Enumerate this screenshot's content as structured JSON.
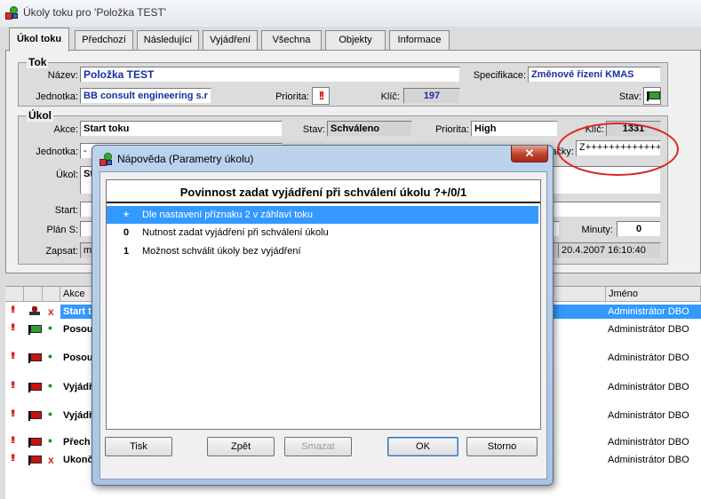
{
  "window": {
    "title": "Úkoly toku pro 'Položka TEST'"
  },
  "tabs": [
    "Úkol toku",
    "Předchozí",
    "Následující",
    "Vyjádření",
    "Všechna",
    "Objekty",
    "Informace"
  ],
  "tok": {
    "group_title": "Tok",
    "nazev_label": "Název:",
    "nazev_value": "Položka TEST",
    "specifikace_label": "Specifikace:",
    "specifikace_value": "Změnové řízení KMAS",
    "jednotka_label": "Jednotka:",
    "jednotka_value": "BB consult engineering s.r",
    "priorita_label": "Priorita:",
    "priorita_icon": "!!",
    "klic_label": "Klíč:",
    "klic_value": "197",
    "stav_label": "Stav:"
  },
  "ukol": {
    "group_title": "Úkol",
    "akce_label": "Akce:",
    "akce_value": "Start toku",
    "stav_label": "Stav:",
    "stav_value": "Schváleno",
    "priorita_label": "Priorita:",
    "priorita_value": "High",
    "klic_label": "Klíč:",
    "klic_value": "1331",
    "jednotka_label": "Jednotka:",
    "jednotka_value": "-",
    "znacky_label": "ačky:",
    "znacky_value": "Z+++++++++++++",
    "ukol_label": "Úkol:",
    "ukol_value": "St",
    "start_label": "Start:",
    "plan_label": "Plán S:",
    "plan_value": "",
    "minuty_label": "Minuty:",
    "minuty_value": "0",
    "zapsat_label": "Zapsat:",
    "zapsat_value": "m",
    "zapsat_date": "20.4.2007 16:10:40"
  },
  "grid": {
    "col_akce": "Akce",
    "col_jmeno": "Jméno",
    "rows": [
      {
        "prio": "!!",
        "icon": "stamp",
        "mark": "x",
        "akce": "Start t",
        "jmeno": "Administrátor DBO",
        "selected": true
      },
      {
        "prio": "!!",
        "icon": "flag-green",
        "mark": "•",
        "akce": "Posou",
        "jmeno": "Administrátor DBO",
        "selected": false
      },
      {
        "prio": "!!",
        "icon": "flag-red",
        "mark": "•",
        "akce": "Posou",
        "jmeno": "Administrátor DBO",
        "selected": false
      },
      {
        "prio": "!!",
        "icon": "flag-red",
        "mark": "•",
        "akce": "Vyjádř",
        "jmeno": "Administrátor DBO",
        "selected": false
      },
      {
        "prio": "!!",
        "icon": "flag-red",
        "mark": "•",
        "akce": "Vyjádř",
        "jmeno": "Administrátor DBO",
        "selected": false
      },
      {
        "prio": "!!",
        "icon": "flag-red",
        "mark": "•",
        "akce": "Přech",
        "jmeno": "Administrátor DBO",
        "selected": false
      },
      {
        "prio": "!!",
        "icon": "flag-red",
        "mark": "x",
        "akce": "Ukonč",
        "jmeno": "Administrátor DBO",
        "selected": false
      }
    ]
  },
  "dialog": {
    "title": "Nápověda (Parametry úkolu)",
    "close_glyph": "✕",
    "heading": "Povinnost zadat vyjádření při schválení úkolu ?+/0/1",
    "options": [
      {
        "key": "+",
        "text": "Dle nastavení příznaku 2 v záhlaví toku",
        "selected": true
      },
      {
        "key": "0",
        "text": "Nutnost zadat vyjádření při schválení úkolu",
        "selected": false
      },
      {
        "key": "1",
        "text": "Možnost schválit úkoly bez vyjádření",
        "selected": false
      }
    ],
    "buttons": {
      "tisk": "Tisk",
      "zpet": "Zpět",
      "smazat": "Smazat",
      "ok": "OK",
      "storno": "Storno"
    }
  }
}
